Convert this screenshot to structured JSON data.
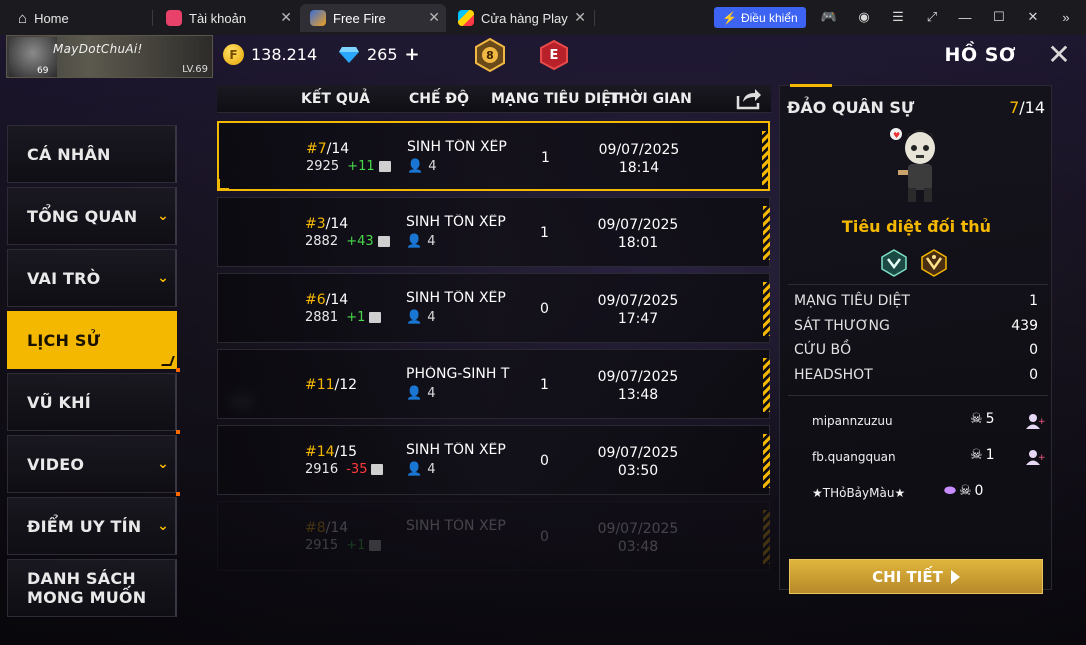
{
  "tabs": {
    "home": "Home",
    "items": [
      {
        "label": "Tài khoản"
      },
      {
        "label": "Free Fire"
      },
      {
        "label": "Cửa hàng Play"
      }
    ],
    "control_button": "Điều khiển"
  },
  "header": {
    "player_name": "MayDotChuAi!",
    "level": "LV.69",
    "avatar_number": "69",
    "gold": "138.214",
    "diamonds": "265",
    "rank_number": "8",
    "rank_letter": "E",
    "title": "HỒ SƠ"
  },
  "menu": [
    {
      "label": "CÁ NHÂN"
    },
    {
      "label": "TỔNG QUAN"
    },
    {
      "label": "VAI TRÒ"
    },
    {
      "label": "LỊCH SỬ"
    },
    {
      "label": "VŨ KHÍ"
    },
    {
      "label": "VIDEO"
    },
    {
      "label": "ĐIỂM UY TÍN"
    },
    {
      "label": "DANH SÁCH"
    },
    {
      "label": "MONG MUỐN"
    }
  ],
  "table": {
    "columns": [
      "KẾT QUẢ",
      "CHẾ ĐỘ",
      "MẠNG TIÊU DIỆT",
      "THỜI GIAN"
    ],
    "rows": [
      {
        "rank": "#7",
        "total": "/14",
        "score": "2925",
        "delta": "+11",
        "mode": "SINH TỒN XẾP HẠNG",
        "players": "4",
        "kills": "1",
        "date": "09/07/2025",
        "time": "18:14"
      },
      {
        "rank": "#3",
        "total": "/14",
        "score": "2882",
        "delta": "+43",
        "mode": "SINH TỒN XẾP HẠNG",
        "players": "4",
        "kills": "1",
        "date": "09/07/2025",
        "time": "18:01"
      },
      {
        "rank": "#6",
        "total": "/14",
        "score": "2881",
        "delta": "+1",
        "mode": "SINH TỒN XẾP HẠNG",
        "players": "4",
        "kills": "0",
        "date": "09/07/2025",
        "time": "17:47"
      },
      {
        "rank": "#11",
        "total": "/12",
        "score": "",
        "delta": "",
        "mode": "PHÒNG-SINH TỒN",
        "players": "4",
        "kills": "1",
        "date": "09/07/2025",
        "time": "13:48"
      },
      {
        "rank": "#14",
        "total": "/15",
        "score": "2916",
        "delta": "-35",
        "mode": "SINH TỒN XẾP HẠNG",
        "players": "4",
        "kills": "0",
        "date": "09/07/2025",
        "time": "03:50"
      },
      {
        "rank": "#8",
        "total": "/14",
        "score": "2915",
        "delta": "+1",
        "mode": "SINH TỒN XẾP HẠNG",
        "players": "",
        "kills": "0",
        "date": "09/07/2025",
        "time": "03:48"
      }
    ]
  },
  "detail": {
    "map": "ĐẢO QUÂN SỰ",
    "rank": "7",
    "rank_total": "/14",
    "achievement": "Tiêu diệt đối thủ",
    "stats": [
      {
        "label": "MẠNG TIÊU DIỆT",
        "value": "1"
      },
      {
        "label": "SÁT THƯƠNG",
        "value": "439"
      },
      {
        "label": "CỨU BỒ",
        "value": "0"
      },
      {
        "label": "HEADSHOT",
        "value": "0"
      }
    ],
    "teammates": [
      {
        "name": "mipannzuzuu",
        "kills": "5"
      },
      {
        "name": "fb.quangquan",
        "kills": "1"
      },
      {
        "name": "★THỏBảyMàu★",
        "kills": "0"
      }
    ],
    "button": "CHI TIẾT"
  },
  "colors": {
    "accent": "#f5b800",
    "positive": "#49d84b",
    "negative": "#ff3b3b",
    "control_blue": "#3d63f2"
  }
}
